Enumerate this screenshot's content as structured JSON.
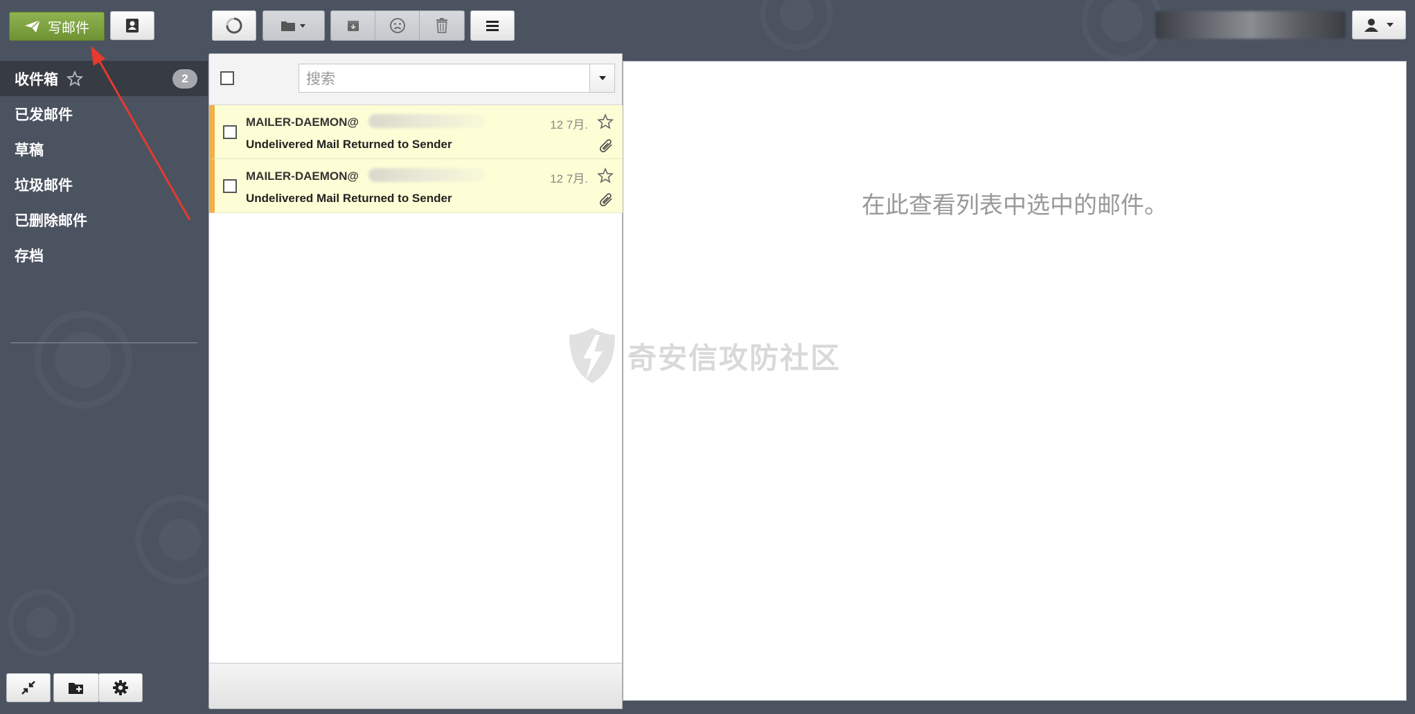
{
  "toolbar": {
    "compose_label": "写邮件",
    "contacts_icon": "contacts-icon",
    "refresh_icon": "refresh-icon",
    "move_icon": "folder-icon",
    "archive_icon": "archive-icon",
    "spam_icon": "frown-icon",
    "delete_icon": "trash-icon",
    "menu_icon": "menu-icon",
    "user_icon": "user-icon"
  },
  "sidebar": {
    "items": [
      {
        "label": "收件箱",
        "badge": "2"
      },
      {
        "label": "已发邮件"
      },
      {
        "label": "草稿"
      },
      {
        "label": "垃圾邮件"
      },
      {
        "label": "已删除邮件"
      },
      {
        "label": "存档"
      }
    ]
  },
  "search": {
    "placeholder": "搜索"
  },
  "messages": [
    {
      "sender": "MAILER-DAEMON@",
      "subject": "Undelivered Mail Returned to Sender",
      "date": "12 7月."
    },
    {
      "sender": "MAILER-DAEMON@",
      "subject": "Undelivered Mail Returned to Sender",
      "date": "12 7月."
    }
  ],
  "preview": {
    "hint": "在此查看列表中选中的邮件。"
  },
  "watermark": {
    "text": "奇安信攻防社区"
  },
  "colors": {
    "background": "#4b5361",
    "compose_green": "#7ea042",
    "unread_row": "#fefed6",
    "unread_stripe": "#f0b04a",
    "annotation_red": "#e53a2e"
  }
}
